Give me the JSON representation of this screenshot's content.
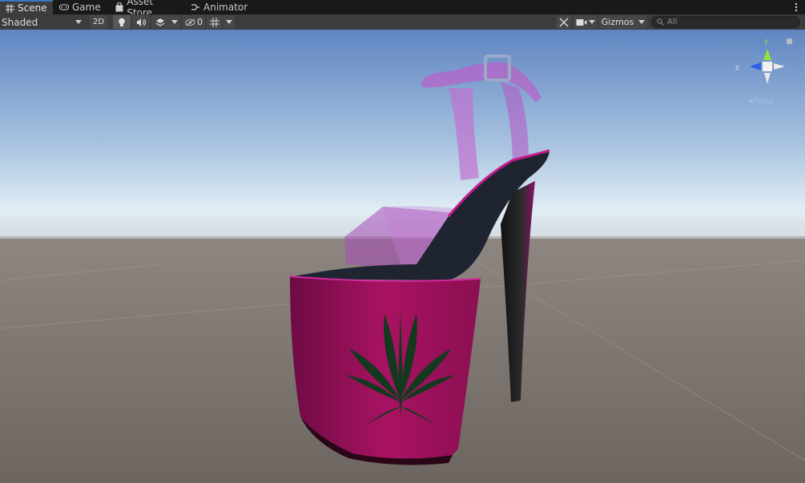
{
  "tabs": [
    {
      "label": "Scene",
      "icon": "grid-icon",
      "active": true
    },
    {
      "label": "Game",
      "icon": "gamepad-icon",
      "active": false
    },
    {
      "label": "Asset Store",
      "icon": "store-bag-icon",
      "active": false
    },
    {
      "label": "Animator",
      "icon": "animator-icon",
      "active": false
    }
  ],
  "toolbar": {
    "draw_mode": "Shaded",
    "mode_2d": "2D",
    "hidden_count": "0",
    "gizmos": "Gizmos",
    "search_placeholder": "All"
  },
  "gizmo": {
    "y_label": "y",
    "z_label": "z",
    "projection": "Persp"
  },
  "colors": {
    "tab_accent": "#3a79bb",
    "platform_magenta": "#a0105c",
    "strap_translucent": "#c86ad6",
    "sole_black": "#1e2530",
    "leaf_green": "#14391e",
    "axis_y": "#8ee43a",
    "axis_z": "#2d62e8"
  }
}
